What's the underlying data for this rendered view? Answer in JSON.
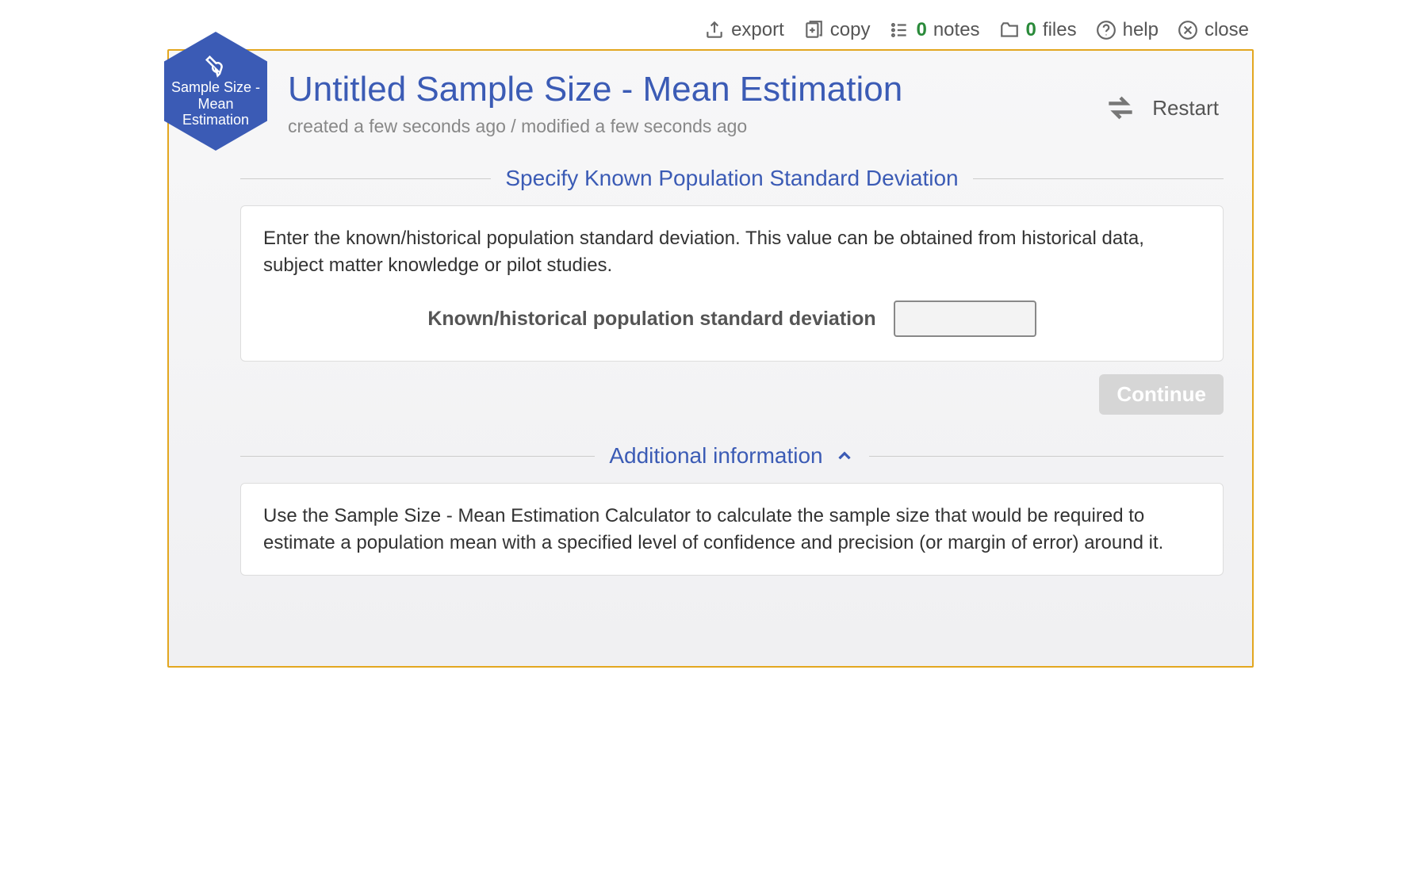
{
  "hexagon": {
    "label": "Sample Size - Mean Estimation"
  },
  "toolbar": {
    "export_label": "export",
    "copy_label": "copy",
    "notes_count": "0",
    "notes_label": "notes",
    "files_count": "0",
    "files_label": "files",
    "help_label": "help",
    "close_label": "close"
  },
  "header": {
    "title": "Untitled Sample Size - Mean Estimation",
    "timestamps": "created a few seconds ago / modified a few seconds ago",
    "restart_label": "Restart"
  },
  "section1": {
    "title": "Specify Known Population Standard Deviation",
    "instruction": "Enter the known/historical population standard deviation. This value can be obtained from historical data, subject matter knowledge or pilot studies.",
    "field_label": "Known/historical population standard deviation",
    "field_value": ""
  },
  "continue_label": "Continue",
  "section2": {
    "title": "Additional information",
    "body": "Use the Sample Size - Mean Estimation Calculator to calculate the sample size that would be required to estimate a population mean with a specified level of confidence and precision (or margin of error) around it."
  }
}
